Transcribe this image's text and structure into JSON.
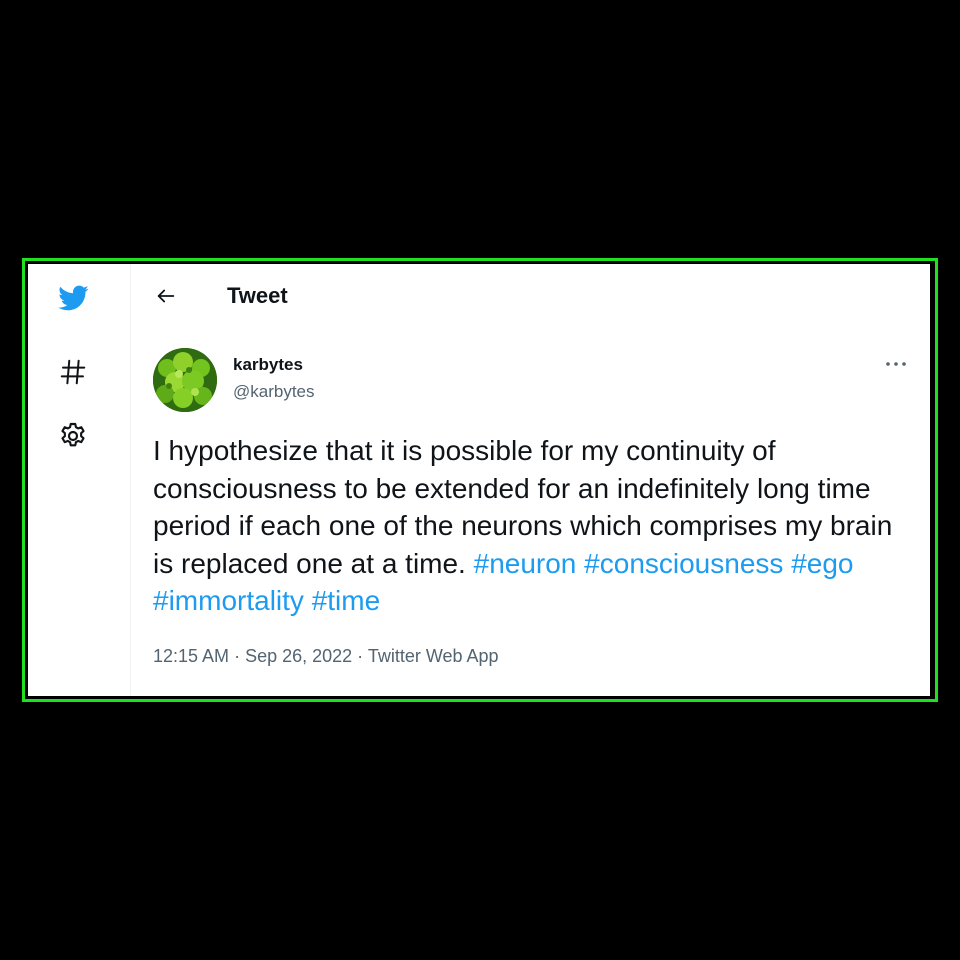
{
  "colors": {
    "frame_border": "#1ee21e",
    "brand": "#1d9bf0",
    "text_primary": "#0f1419",
    "text_secondary": "#536471"
  },
  "sidebar": {
    "items": [
      {
        "icon": "twitter-bird-icon"
      },
      {
        "icon": "hashtag-explore-icon"
      },
      {
        "icon": "gear-settings-icon"
      }
    ]
  },
  "header": {
    "back_icon": "back-arrow-icon",
    "title": "Tweet"
  },
  "tweet": {
    "author": {
      "name": "karbytes",
      "handle": "@karbytes",
      "avatar": "green-broccoli-avatar"
    },
    "more_icon": "more-options-icon",
    "text_body": "I hypothesize that it is possible for my continuity of consciousness to be extended for an indefinitely long time period if each one of the neurons which comprises my brain is replaced one at a time. ",
    "hashtags": [
      "#neuron",
      "#consciousness",
      "#ego",
      "#immortality",
      "#time"
    ],
    "time": "12:15 AM",
    "separator": " · ",
    "date": "Sep 26, 2022",
    "source": "Twitter Web App"
  }
}
